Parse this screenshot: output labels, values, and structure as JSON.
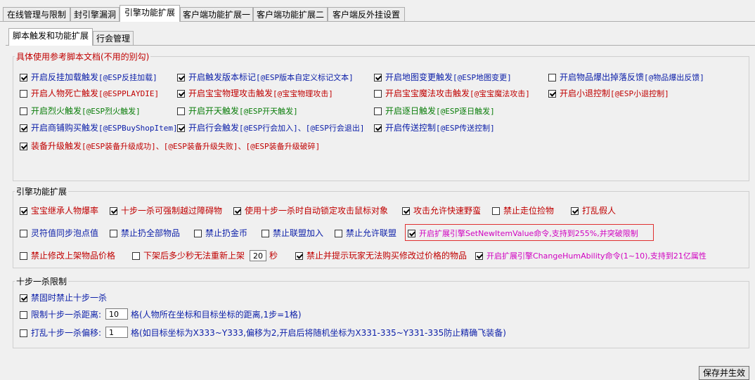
{
  "main_tabs": [
    "在线管理与限制",
    "封引擎漏洞",
    "引擎功能扩展",
    "客户端功能扩展一",
    "客户端功能扩展二",
    "客户端反外挂设置"
  ],
  "sub_tabs": [
    "脚本触发和功能扩展",
    "行会管理"
  ],
  "group1": {
    "title": "具体使用参考脚本文档(不用的别勾)",
    "items": [
      {
        "label": "开启反挂加载触发",
        "code": "[@ESP反挂加载]",
        "checked": true
      },
      {
        "label": "开启触发版本标记",
        "code": "[@ESP版本自定义标记文本]",
        "checked": true
      },
      {
        "label": "开启地图变更触发",
        "code": "[@ESP地图变更]",
        "checked": true
      },
      {
        "label": "开启物品爆出掉落反馈",
        "code": "[@物品爆出反馈]",
        "checked": false
      },
      {
        "label": "开启人物死亡触发",
        "code": "[@ESPPLAYDIE]",
        "checked": false
      },
      {
        "label": "开启宝宝物理攻击触发",
        "code": "[@宝宝物理攻击]",
        "checked": true
      },
      {
        "label": "开启宝宝魔法攻击触发",
        "code": "[@宝宝魔法攻击]",
        "checked": false
      },
      {
        "label": "开启小退控制",
        "code": "[@ESP小退控制]",
        "checked": true
      },
      {
        "label": "开启烈火触发",
        "code": "[@ESP烈火触发]",
        "checked": false
      },
      {
        "label": "开启开天触发",
        "code": "[@ESP开天触发]",
        "checked": false
      },
      {
        "label": "开启逐日触发",
        "code": "[@ESP逐日触发]",
        "checked": false
      },
      {
        "label": "开启商铺购买触发",
        "code": "[@ESPBuyShopItem]",
        "checked": true
      },
      {
        "label": "开启行会触发",
        "code": "[@ESP行会加入]、[@ESP行会退出]",
        "checked": true
      },
      {
        "label": "开启传送控制",
        "code": "[@ESP传送控制]",
        "checked": true
      },
      {
        "label": "装备升级触发",
        "code": "[@ESP装备升级成功]、[@ESP装备升级失败]、[@ESP装备升级破碎]",
        "checked": true
      }
    ]
  },
  "group2": {
    "title": "引擎功能扩展",
    "items": [
      {
        "label": "宝宝继承人物爆率",
        "checked": true
      },
      {
        "label": "十步一杀可强制越过障碍物",
        "checked": true
      },
      {
        "label": "使用十步一杀时自动锁定攻击鼠标对象",
        "checked": true
      },
      {
        "label": "攻击允许快速野蛮",
        "checked": true
      },
      {
        "label": "禁止走位捡物",
        "checked": false
      },
      {
        "label": "打乱假人",
        "checked": true
      },
      {
        "label": "灵符值同步泡点值",
        "checked": false
      },
      {
        "label": "禁止扔全部物品",
        "checked": false
      },
      {
        "label": "禁止扔金币",
        "checked": false
      },
      {
        "label": "禁止联盟加入",
        "checked": false
      },
      {
        "label": "禁止允许联盟",
        "checked": false
      },
      {
        "label": "开启扩展引擎SetNewItemValue命令,支持到255%,并突破限制",
        "checked": true
      },
      {
        "label": "禁止修改上架物品价格",
        "checked": false
      },
      {
        "label": "下架后多少秒无法重新上架",
        "checked": false,
        "value": "20",
        "unit": "秒"
      },
      {
        "label": "禁止并提示玩家无法购买修改过价格的物品",
        "checked": true
      },
      {
        "label": "开启扩展引擎ChangeHumAbility命令(1~10),支持到21亿属性",
        "checked": true
      }
    ]
  },
  "group3": {
    "title": "十步一杀限制",
    "items": [
      {
        "label": "禁固时禁止十步一杀",
        "checked": true
      },
      {
        "label": "限制十步一杀距离:",
        "checked": false,
        "value": "10",
        "suffix": "格(人物所在坐标和目标坐标的距离,1步=1格)"
      },
      {
        "label": "打乱十步一杀偏移:",
        "checked": false,
        "value": "1",
        "suffix": "格(如目标坐标为X333~Y333,偏移为2,开启后将随机坐标为X331-335~Y331-335防止精确飞装备)"
      }
    ]
  },
  "save_button": "保存并生效"
}
